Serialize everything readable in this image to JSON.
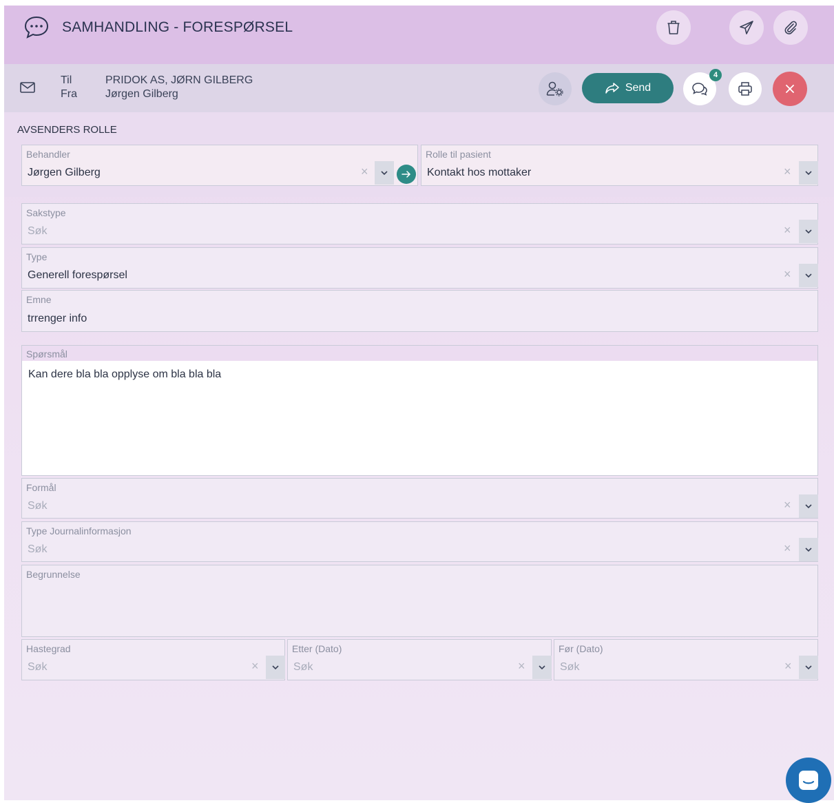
{
  "header": {
    "title": "SAMHANDLING - FORESPØRSEL",
    "icons": [
      "chat-bubble-icon",
      "trash-icon",
      "paper-plane-icon",
      "paperclip-icon"
    ]
  },
  "toolbar": {
    "to_label": "Til",
    "from_label": "Fra",
    "to_value": "PRIDOK AS, JØRN GILBERG",
    "from_value": "Jørgen Gilberg",
    "send_label": "Send",
    "comments_badge": "4",
    "icons": [
      "mail-icon",
      "user-settings-icon",
      "forward-icon",
      "comments-icon",
      "print-icon",
      "close-icon"
    ]
  },
  "role_section": {
    "title": "AVSENDERS ROLLE",
    "behandler": {
      "label": "Behandler",
      "value": "Jørgen Gilberg"
    },
    "rolle": {
      "label": "Rolle til pasient",
      "value": "Kontakt hos mottaker"
    }
  },
  "form": {
    "sakstype": {
      "label": "Sakstype",
      "placeholder": "Søk"
    },
    "type": {
      "label": "Type",
      "value": "Generell forespørsel"
    },
    "emne": {
      "label": "Emne",
      "value": "trrenger info"
    },
    "sporsmal": {
      "label": "Spørsmål",
      "value": "Kan dere bla bla opplyse om bla bla bla"
    },
    "formal": {
      "label": "Formål",
      "placeholder": "Søk"
    },
    "type_journal": {
      "label": "Type Journalinformasjon",
      "placeholder": "Søk"
    },
    "begrunnelse": {
      "label": "Begrunnelse"
    },
    "hastegrad": {
      "label": "Hastegrad",
      "placeholder": "Søk"
    },
    "etter": {
      "label": "Etter (Dato)",
      "placeholder": "Søk"
    },
    "for": {
      "label": "Før (Dato)",
      "placeholder": "Søk"
    }
  },
  "colors": {
    "header_bg": "#dcbfe6",
    "send_button": "#2e7d7f",
    "close_button": "#e06470",
    "chat_fab": "#1f6fb5"
  }
}
